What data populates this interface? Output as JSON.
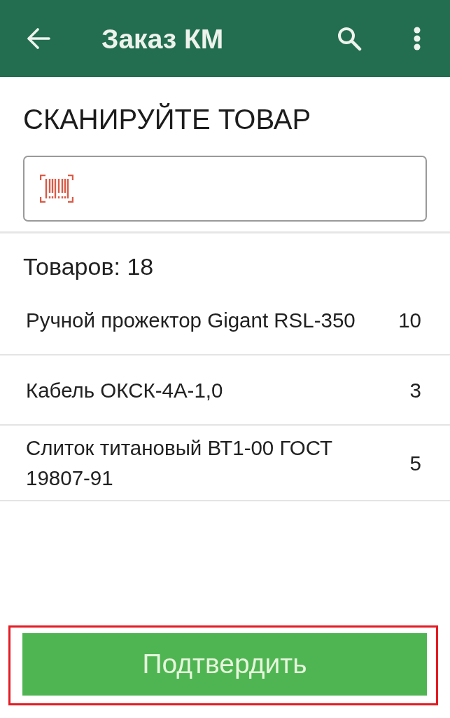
{
  "app_bar": {
    "title": "Заказ КМ"
  },
  "scan": {
    "heading": "СКАНИРУЙТЕ ТОВАР"
  },
  "items_count": "Товаров: 18",
  "items": [
    {
      "name": "Ручной прожектор Gigant RSL-350",
      "quantity": "10"
    },
    {
      "name": "Кабель ОКСК-4А-1,0",
      "quantity": "3"
    },
    {
      "name": "Слиток титановый ВТ1-00 ГОСТ 19807-91",
      "quantity": "5"
    }
  ],
  "confirm_button": {
    "label": "Подтвердить",
    "highlighted": true
  }
}
